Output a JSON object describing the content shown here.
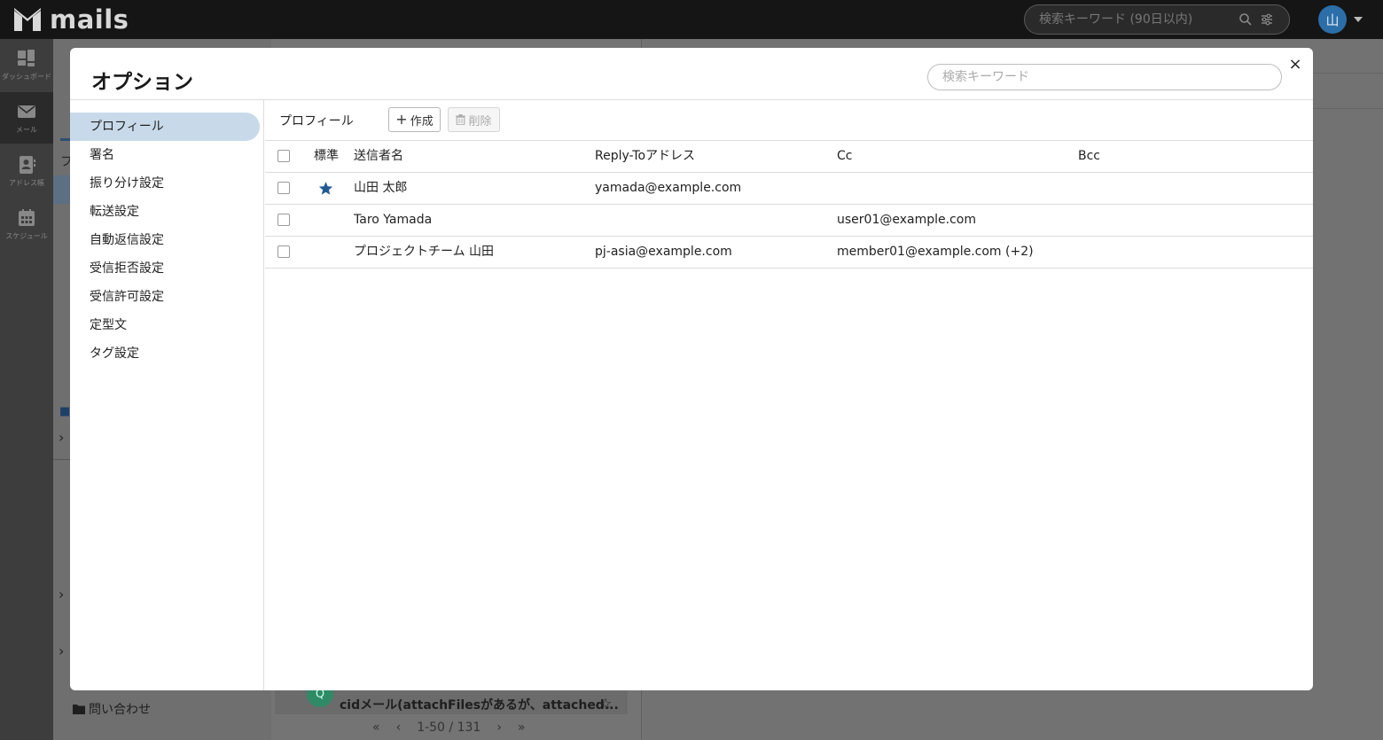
{
  "app": {
    "name": "mails",
    "search_placeholder": "検索キーワード (90日以内)",
    "user_initial": "山"
  },
  "leftnav": [
    {
      "label": "ダッシュボード",
      "icon": "dashboard-icon"
    },
    {
      "label": "メール",
      "icon": "mail-icon"
    },
    {
      "label": "アドレス帳",
      "icon": "address-book-icon"
    },
    {
      "label": "スケジュール",
      "icon": "calendar-icon"
    }
  ],
  "background": {
    "folder_label": "問い合わせ",
    "first_letter": "フ",
    "mail_subject": "cidメール(attachFilesがあるが、attached...",
    "mail_avatar": "Q",
    "pager": "1-50 / 131"
  },
  "modal": {
    "title": "オプション",
    "search_placeholder": "検索キーワード",
    "close_label": "×",
    "nav": [
      {
        "label": "プロフィール",
        "active": true
      },
      {
        "label": "署名"
      },
      {
        "label": "振り分け設定"
      },
      {
        "label": "転送設定"
      },
      {
        "label": "自動返信設定"
      },
      {
        "label": "受信拒否設定"
      },
      {
        "label": "受信許可設定"
      },
      {
        "label": "定型文"
      },
      {
        "label": "タグ設定"
      }
    ],
    "section_title": "プロフィール",
    "create_label": "作成",
    "delete_label": "削除",
    "columns": {
      "default": "標準",
      "sender": "送信者名",
      "reply_to": "Reply-Toアドレス",
      "cc": "Cc",
      "bcc": "Bcc"
    },
    "rows": [
      {
        "is_default": true,
        "sender": "山田 太郎",
        "reply_to": "yamada@example.com",
        "cc": "",
        "bcc": ""
      },
      {
        "is_default": false,
        "sender": "Taro Yamada",
        "reply_to": "",
        "cc": "user01@example.com",
        "bcc": ""
      },
      {
        "is_default": false,
        "sender": "プロジェクトチーム 山田",
        "reply_to": "pj-asia@example.com",
        "cc": "member01@example.com (+2)",
        "bcc": ""
      }
    ]
  },
  "colors": {
    "accent": "#1f5a94",
    "nav_active": "#c8daea",
    "topbar": "#151515"
  }
}
